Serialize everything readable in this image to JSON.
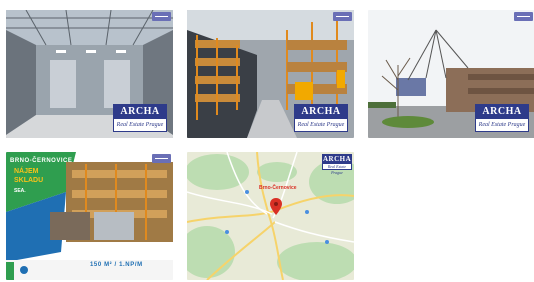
{
  "gallery": {
    "items": [
      {
        "alt": "Hall interior",
        "logo_word": "ARCHA",
        "logo_sub": "Real Estate Prague"
      },
      {
        "alt": "Warehouse racks",
        "logo_word": "ARCHA",
        "logo_sub": "Real Estate Prague"
      },
      {
        "alt": "Building exterior",
        "logo_word": "ARCHA",
        "logo_sub": "Real Estate Prague"
      },
      {
        "alt": "Flyer"
      },
      {
        "alt": "Map",
        "logo_word": "ARCHA",
        "logo_sub": "Real Estate Prague"
      }
    ]
  },
  "flyer": {
    "location": "BRNO-ČERNOVICE",
    "headline_1": "NÁJEM",
    "headline_2": "SKLADU",
    "sub": "SEA.",
    "area": "150 M² / 1.NP/M",
    "colors": {
      "green": "#2f9e4f",
      "blue": "#1f6fb3",
      "accent": "#f6c21b"
    }
  },
  "map": {
    "pin_label": "Brno-Černovice",
    "pin_color": "#d93025"
  }
}
